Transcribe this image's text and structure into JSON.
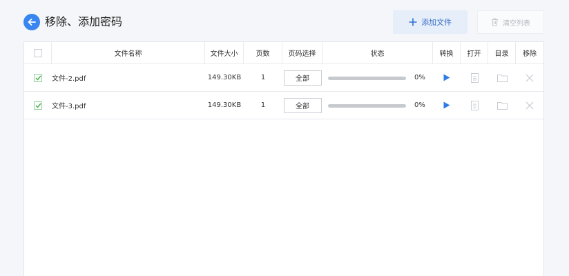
{
  "header": {
    "title": "移除、添加密码",
    "add_file_label": "添加文件",
    "clear_list_label": "清空列表"
  },
  "table": {
    "columns": {
      "name": "文件名称",
      "size": "文件大小",
      "pages": "页数",
      "range": "页码选择",
      "status": "状态",
      "convert": "转换",
      "open": "打开",
      "directory": "目录",
      "remove": "移除"
    },
    "rows": [
      {
        "checked": true,
        "name": "文件-2.pdf",
        "size": "149.30KB",
        "pages": "1",
        "range": "全部",
        "progress_text": "0%",
        "progress": 0
      },
      {
        "checked": true,
        "name": "文件-3.pdf",
        "size": "149.30KB",
        "pages": "1",
        "range": "全部",
        "progress_text": "0%",
        "progress": 0
      }
    ]
  },
  "colors": {
    "accent": "#3a86f0",
    "check": "#4caf50",
    "play": "#2f7de1",
    "disabled_icon": "#c8ccd2"
  },
  "icons": {
    "back": "arrow-left-icon",
    "add": "plus-icon",
    "clear": "trash-icon",
    "convert": "play-icon",
    "open": "document-icon",
    "directory": "folder-icon",
    "remove": "close-icon"
  }
}
